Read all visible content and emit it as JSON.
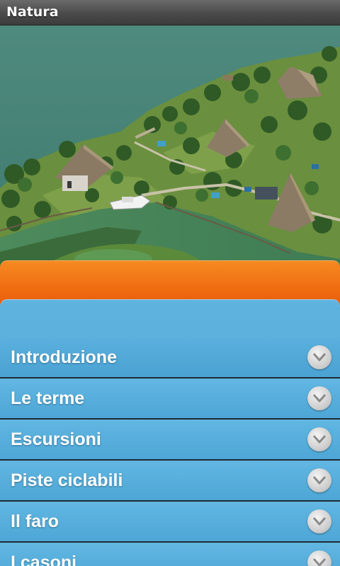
{
  "titlebar": {
    "title": "Natura"
  },
  "hero": {
    "image": "aerial-lagoon-thatched-huts"
  },
  "menu": {
    "items": [
      {
        "label": "Introduzione",
        "icon": "chevron-down-icon"
      },
      {
        "label": "Le terme",
        "icon": "chevron-down-icon"
      },
      {
        "label": "Escursioni",
        "icon": "chevron-down-icon"
      },
      {
        "label": "Piste ciclabili",
        "icon": "chevron-down-icon"
      },
      {
        "label": "Il faro",
        "icon": "chevron-down-icon"
      },
      {
        "label": "I casoni",
        "icon": "chevron-down-icon"
      }
    ]
  },
  "colors": {
    "accent_orange": "#f06a10",
    "menu_blue": "#52a9d8",
    "titlebar": "#4a4a4a"
  }
}
